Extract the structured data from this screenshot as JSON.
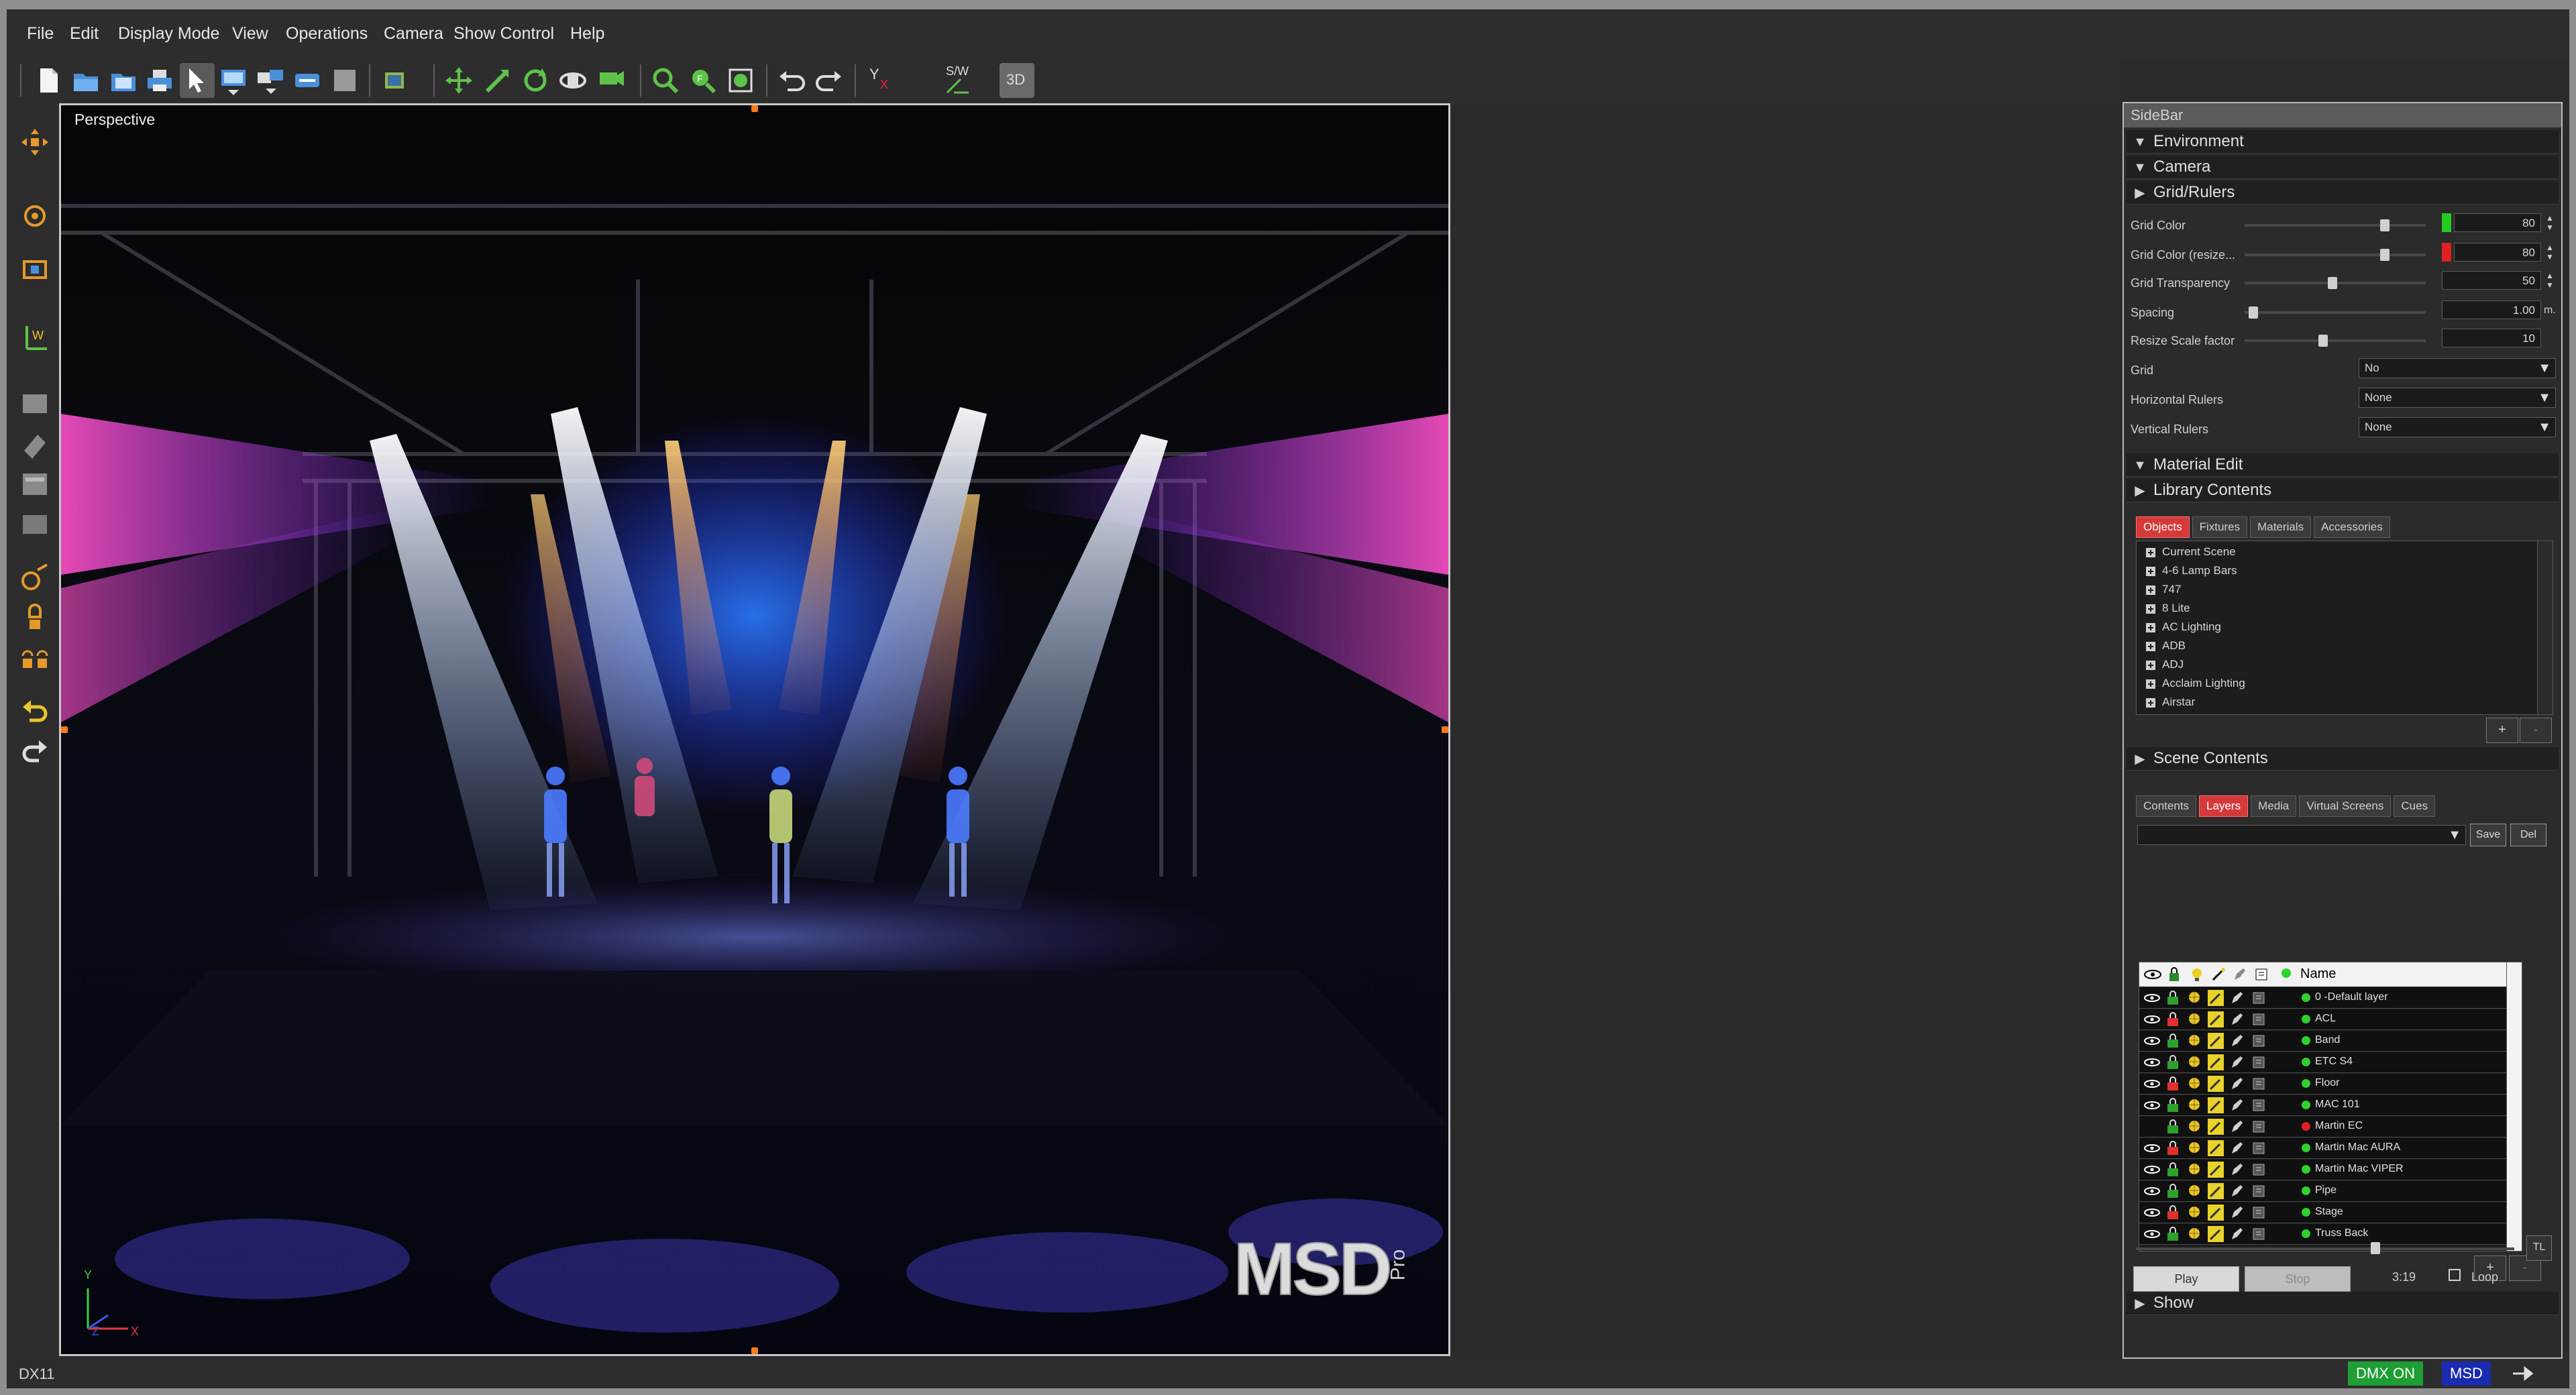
{
  "menu": [
    "File",
    "Edit",
    "Display Mode",
    "View",
    "Operations",
    "Camera",
    "Show Control",
    "Help"
  ],
  "toolbar": {
    "tools": [
      "new-file-icon",
      "open-file-icon",
      "open-folder-icon",
      "print-icon",
      "select-arrow-icon",
      "monitor-icon",
      "multi-window-icon",
      "link-icon",
      "gray-square-icon",
      "fixture-icon",
      "move-icon",
      "scale-icon",
      "rotate-icon",
      "camera-orbit-icon",
      "camera-pan-icon",
      "zoom-in-icon",
      "zoom-fit-icon",
      "zoom-extents-icon",
      "undo-icon",
      "redo-icon",
      "axis-yx-icon",
      "axis-sw-icon",
      "view-3d-icon"
    ],
    "axis_label": "Y",
    "axis_sub": "X",
    "sw_label": "S/W",
    "view3d_label": "3D"
  },
  "viewport": {
    "label": "Perspective",
    "axis_y": "Y",
    "axis_z": "Z",
    "axis_x": "X",
    "logo_text": "MSD",
    "logo_sub": "Pro"
  },
  "sidebar": {
    "title": "SideBar",
    "sections": {
      "environment": "Environment",
      "camera": "Camera",
      "grid_rulers": "Grid/Rulers",
      "material_edit": "Material Edit",
      "library_contents": "Library Contents",
      "scene_contents": "Scene Contents",
      "show": "Show"
    },
    "grid": {
      "grid_color_label": "Grid Color",
      "grid_color_value": "80",
      "grid_color_resize_label": "Grid Color (resize...",
      "grid_color_resize_value": "80",
      "grid_transparency_label": "Grid Transparency",
      "grid_transparency_value": "50",
      "spacing_label": "Spacing",
      "spacing_value": "1.00",
      "spacing_unit": "m.",
      "resize_scale_label": "Resize Scale factor",
      "resize_scale_value": "10",
      "grid_label": "Grid",
      "grid_value": "No",
      "horizontal_rulers_label": "Horizontal Rulers",
      "horizontal_rulers_value": "None",
      "vertical_rulers_label": "Vertical Rulers",
      "vertical_rulers_value": "None"
    },
    "library": {
      "tabs": [
        "Objects",
        "Fixtures",
        "Materials",
        "Accessories"
      ],
      "items": [
        "Current Scene",
        "4-6 Lamp Bars",
        "747",
        "8 Lite",
        "AC Lighting",
        "ADB",
        "ADJ",
        "Acclaim Lighting",
        "Airstar"
      ],
      "add_label": "+",
      "remove_label": "-"
    },
    "scene": {
      "tabs": [
        "Contents",
        "Layers",
        "Media",
        "Virtual Screens",
        "Cues"
      ],
      "save_label": "Save",
      "del_label": "Del",
      "name_header": "Name",
      "layers": [
        {
          "name": "0 -Default layer",
          "status": "#2ed12e"
        },
        {
          "name": "ACL",
          "status": "#2ed12e"
        },
        {
          "name": "Band",
          "status": "#2ed12e"
        },
        {
          "name": "ETC S4",
          "status": "#2ed12e"
        },
        {
          "name": "Floor",
          "status": "#2ed12e"
        },
        {
          "name": "MAC 101",
          "status": "#2ed12e"
        },
        {
          "name": "Martin EC",
          "status": "#e02020"
        },
        {
          "name": "Martin Mac AURA",
          "status": "#2ed12e"
        },
        {
          "name": "Martin Mac VIPER",
          "status": "#2ed12e"
        },
        {
          "name": "Pipe",
          "status": "#2ed12e"
        },
        {
          "name": "Stage",
          "status": "#2ed12e"
        },
        {
          "name": "Truss Back",
          "status": "#2ed12e"
        }
      ],
      "add_label": "+",
      "remove_label": "-"
    },
    "show": {
      "tl_label": "TL",
      "play_label": "Play",
      "stop_label": "Stop",
      "time": "3:19",
      "loop_label": "Loop"
    }
  },
  "status": {
    "renderer": "DX11",
    "dmx": "DMX ON",
    "msd": "MSD",
    "dmx_color": "#1f9e35",
    "msd_color": "#1a2bb0"
  }
}
